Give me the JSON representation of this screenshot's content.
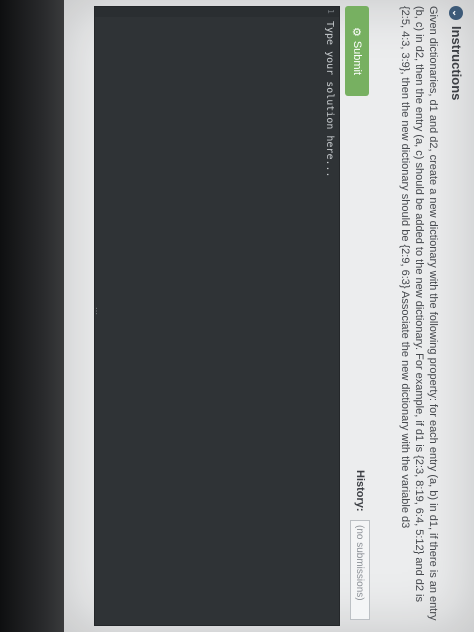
{
  "instructions": {
    "header": "Instructions",
    "text": "Given dictionaries, d1 and d2, create a new dictionary with the following property: for each entry (a, b) in d1, if there is an entry (b, c) in d2, then the entry (a, c) should be added to the new dictionary. For example, if d1 is {2:3, 8:19, 6:4, 5:12} and d2 is {2:5, 4:3, 3:9}, then the new dictionary should be {2:9, 6:3} Associate the new dictionary with the variable d3"
  },
  "submit": {
    "label": "Submit",
    "icon": "gear-icon"
  },
  "history": {
    "label": "History:",
    "value": "(no submissions)"
  },
  "editor": {
    "line_number": "1",
    "placeholder": "Type your solution here...",
    "resize_handle": "⋯"
  }
}
